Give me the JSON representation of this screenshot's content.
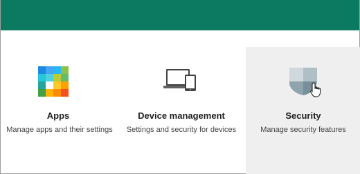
{
  "colors": {
    "topbar": "#0c7a61",
    "selected_tile_bg": "#efefef"
  },
  "tiles": [
    {
      "title": "Apps",
      "description": "Manage apps and their settings",
      "icon": "apps-grid-icon"
    },
    {
      "title": "Device management",
      "description": "Settings and security for devices",
      "icon": "laptop-phone-icon"
    },
    {
      "title": "Security",
      "description": "Manage security features",
      "icon": "shield-icon",
      "hovered": true
    }
  ],
  "cursor": "hand-pointer-icon"
}
